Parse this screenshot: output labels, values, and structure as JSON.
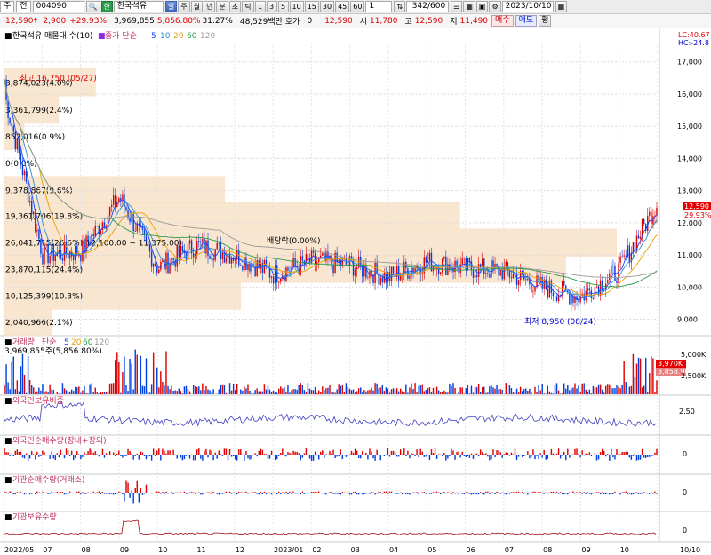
{
  "toolbar1": {
    "mode": "주",
    "market": "전",
    "code": "004090",
    "name": "한국석유",
    "period_buttons": [
      "일",
      "주",
      "월",
      "년",
      "분",
      "초",
      "틱"
    ],
    "interval_buttons": [
      "1",
      "3",
      "5",
      "10",
      "15",
      "30",
      "45",
      "60"
    ],
    "count_field": "1",
    "page": "342/600",
    "date": "2023/10/10"
  },
  "quote": {
    "price": "12,590",
    "change": "2,900",
    "rate": "+29.93%",
    "volume": "3,969,855",
    "vol_ratio": "5,856.80%",
    "turnover": "31.27%",
    "amount": "48,529백만",
    "hoga_label": "호가",
    "hoga_value": "0",
    "hoga_price": "12,590",
    "open_label": "시",
    "open": "11,780",
    "high_label": "고",
    "high": "12,590",
    "low_label": "저",
    "low": "11,490",
    "buy": "매수",
    "sell": "매도",
    "avg": "평"
  },
  "panels": {
    "price": {
      "title": "한국석유 매물대 수(10)",
      "ma_legend_prefix": "종가 단순",
      "ma_periods": [
        {
          "label": "5",
          "color": "#1e40ff"
        },
        {
          "label": "10",
          "color": "#2a8fd0"
        },
        {
          "label": "20",
          "color": "#e8a000"
        },
        {
          "label": "60",
          "color": "#2a9a4a"
        },
        {
          "label": "120",
          "color": "#999999"
        }
      ],
      "lc_label": "LC:40.67",
      "hc_label": "HC:-24.8",
      "current_price_tag": "12,590",
      "current_rate_tag": "29.93%",
      "y_ticks": [
        "17,000",
        "16,000",
        "15,000",
        "14,000",
        "13,000",
        "12,000",
        "11,000",
        "10,000",
        "9,000"
      ],
      "ymin": 8600,
      "ymax": 17600,
      "high_marker": "최고 16,750 (05/27)",
      "low_marker": "최저 8,950 (08/24)",
      "dividend_marker": "배당락(0.00%)",
      "volume_profile": [
        {
          "price": 16350,
          "label": "3,874,023(4.0%)",
          "share": 4.0
        },
        {
          "price": 15500,
          "label": "3,361,799(2.4%)",
          "share": 2.4
        },
        {
          "price": 14680,
          "label": "852,016(0.9%)",
          "share": 0.9
        },
        {
          "price": 13850,
          "label": "0(0.0%)",
          "share": 0.0
        },
        {
          "price": 13000,
          "label": "9,378,867(9.6%)",
          "share": 9.6
        },
        {
          "price": 12200,
          "label": "19,361,706(19.8%)",
          "share": 19.8
        },
        {
          "price": 11370,
          "label": "26,041,715(26.6%)(12,100.00 ~ 11,375.00)",
          "share": 26.6
        },
        {
          "price": 10550,
          "label": "23,870,115(24.4%)",
          "share": 24.4
        },
        {
          "price": 9720,
          "label": "10,125,399(10.3%)",
          "share": 10.3
        },
        {
          "price": 8900,
          "label": "2,040,966(2.1%)",
          "share": 2.1
        }
      ]
    },
    "volume": {
      "title": "거래량",
      "ma_legend_prefix": "단순",
      "ma_periods": [
        {
          "label": "5",
          "color": "#1e40ff"
        },
        {
          "label": "20",
          "color": "#e8a000"
        },
        {
          "label": "60",
          "color": "#2a9a4a"
        },
        {
          "label": "120",
          "color": "#999999"
        }
      ],
      "value_line": "3,969,855주(5,856.80%)",
      "y_tick": "5,000K",
      "y_tick2": "2,500K",
      "tag1": "3,970K",
      "tag2": "3,858.90"
    },
    "foreign_ratio": {
      "title": "외국인보유비중",
      "y_tick": "2.50"
    },
    "foreign_net": {
      "title": "외국인순매수량(장내+장외)",
      "y_tick": "0"
    },
    "inst_net": {
      "title": "기관순매수량(거래소)",
      "y_tick": "0"
    },
    "inst_hold": {
      "title": "기관보유수량",
      "y_tick": "0"
    }
  },
  "x_axis": [
    "2022/05",
    "07",
    "08",
    "09",
    "10",
    "11",
    "12",
    "2023/01",
    "02",
    "03",
    "04",
    "05",
    "06",
    "07",
    "08",
    "09",
    "10",
    "10/10"
  ],
  "chart_data": {
    "type": "candlestick",
    "title": "한국석유 매물대 수(10)",
    "period_start": "2022/05",
    "period_end": "2023/10/10",
    "ylim": [
      8600,
      17600
    ],
    "monthly_close_approx": [
      {
        "month": "2022/05",
        "close": 16000
      },
      {
        "month": "2022/06",
        "close": 11000
      },
      {
        "month": "2022/07",
        "close": 11100
      },
      {
        "month": "2022/08",
        "close": 12800
      },
      {
        "month": "2022/09",
        "close": 10600
      },
      {
        "month": "2022/10",
        "close": 11300
      },
      {
        "month": "2022/11",
        "close": 11000
      },
      {
        "month": "2022/12",
        "close": 10400
      },
      {
        "month": "2023/01",
        "close": 10800
      },
      {
        "month": "2023/02",
        "close": 10700
      },
      {
        "month": "2023/03",
        "close": 10300
      },
      {
        "month": "2023/04",
        "close": 10800
      },
      {
        "month": "2023/05",
        "close": 10600
      },
      {
        "month": "2023/06",
        "close": 10500
      },
      {
        "month": "2023/07",
        "close": 10000
      },
      {
        "month": "2023/08",
        "close": 9700
      },
      {
        "month": "2023/09",
        "close": 10500
      },
      {
        "month": "2023/10/10",
        "close": 12590
      }
    ],
    "max": {
      "value": 16750,
      "date": "05/27"
    },
    "min": {
      "value": 8950,
      "date": "08/24"
    }
  }
}
